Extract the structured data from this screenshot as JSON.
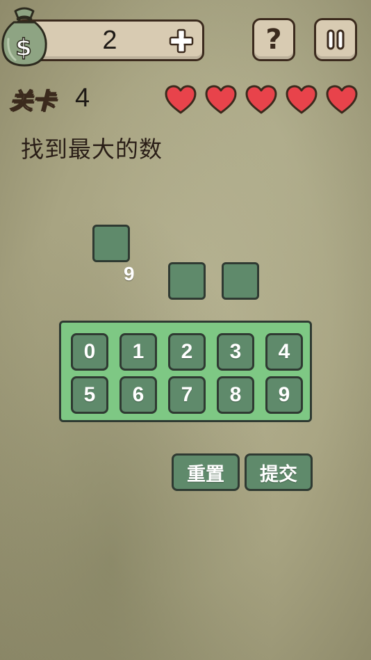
{
  "header": {
    "coins": "2",
    "coin_icon": "money-bag-icon",
    "add_icon": "plus-icon",
    "help_label": "?",
    "pause_icon": "pause-icon"
  },
  "level": {
    "label": "关卡",
    "number": "4",
    "lives": 5,
    "heart_color": "#e8434b"
  },
  "instruction": "找到最大的数",
  "answer": {
    "slots": [
      "",
      "",
      ""
    ],
    "floating_digit": "9"
  },
  "keypad": {
    "keys": [
      "0",
      "1",
      "2",
      "3",
      "4",
      "5",
      "6",
      "7",
      "8",
      "9"
    ]
  },
  "actions": {
    "reset": "重置",
    "submit": "提交"
  },
  "colors": {
    "tile": "#5f8a6b",
    "keypad_bg": "#7ec884",
    "outline": "#2f3a32",
    "panel": "#d8cbb2"
  }
}
